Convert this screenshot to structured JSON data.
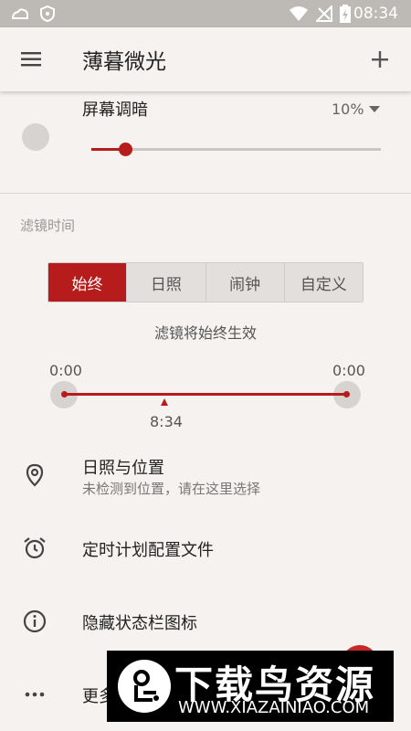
{
  "status_bar": {
    "time": "08:34"
  },
  "app_bar": {
    "title": "薄暮微光",
    "menu_icon": "menu-icon",
    "add_icon": "add-icon"
  },
  "dim": {
    "label": "屏幕调暗",
    "value": "10%",
    "level": 0.1
  },
  "filter": {
    "section_title": "滤镜时间",
    "modes": [
      "始终",
      "日照",
      "闹钟",
      "自定义"
    ],
    "active_mode": "始终",
    "status": "滤镜将始终生效",
    "start_time": "0:00",
    "end_time": "0:00",
    "current_time": "8:34"
  },
  "list": [
    {
      "icon": "location-pin-icon",
      "title": "日照与位置",
      "subtitle": "未检测到位置，请在这里选择"
    },
    {
      "icon": "alarm-clock-icon",
      "title": "定时计划配置文件"
    },
    {
      "icon": "info-icon",
      "title": "隐藏状态栏图标"
    },
    {
      "icon": "more-horiz-icon",
      "title": "更多"
    }
  ],
  "watermark": {
    "name": "下载鸟资源",
    "url": "WWW.XIAZAINIAO.COM"
  },
  "colors": {
    "accent": "#b71c1c",
    "background": "#f5f2ef",
    "status_bar": "#bdbab6"
  }
}
